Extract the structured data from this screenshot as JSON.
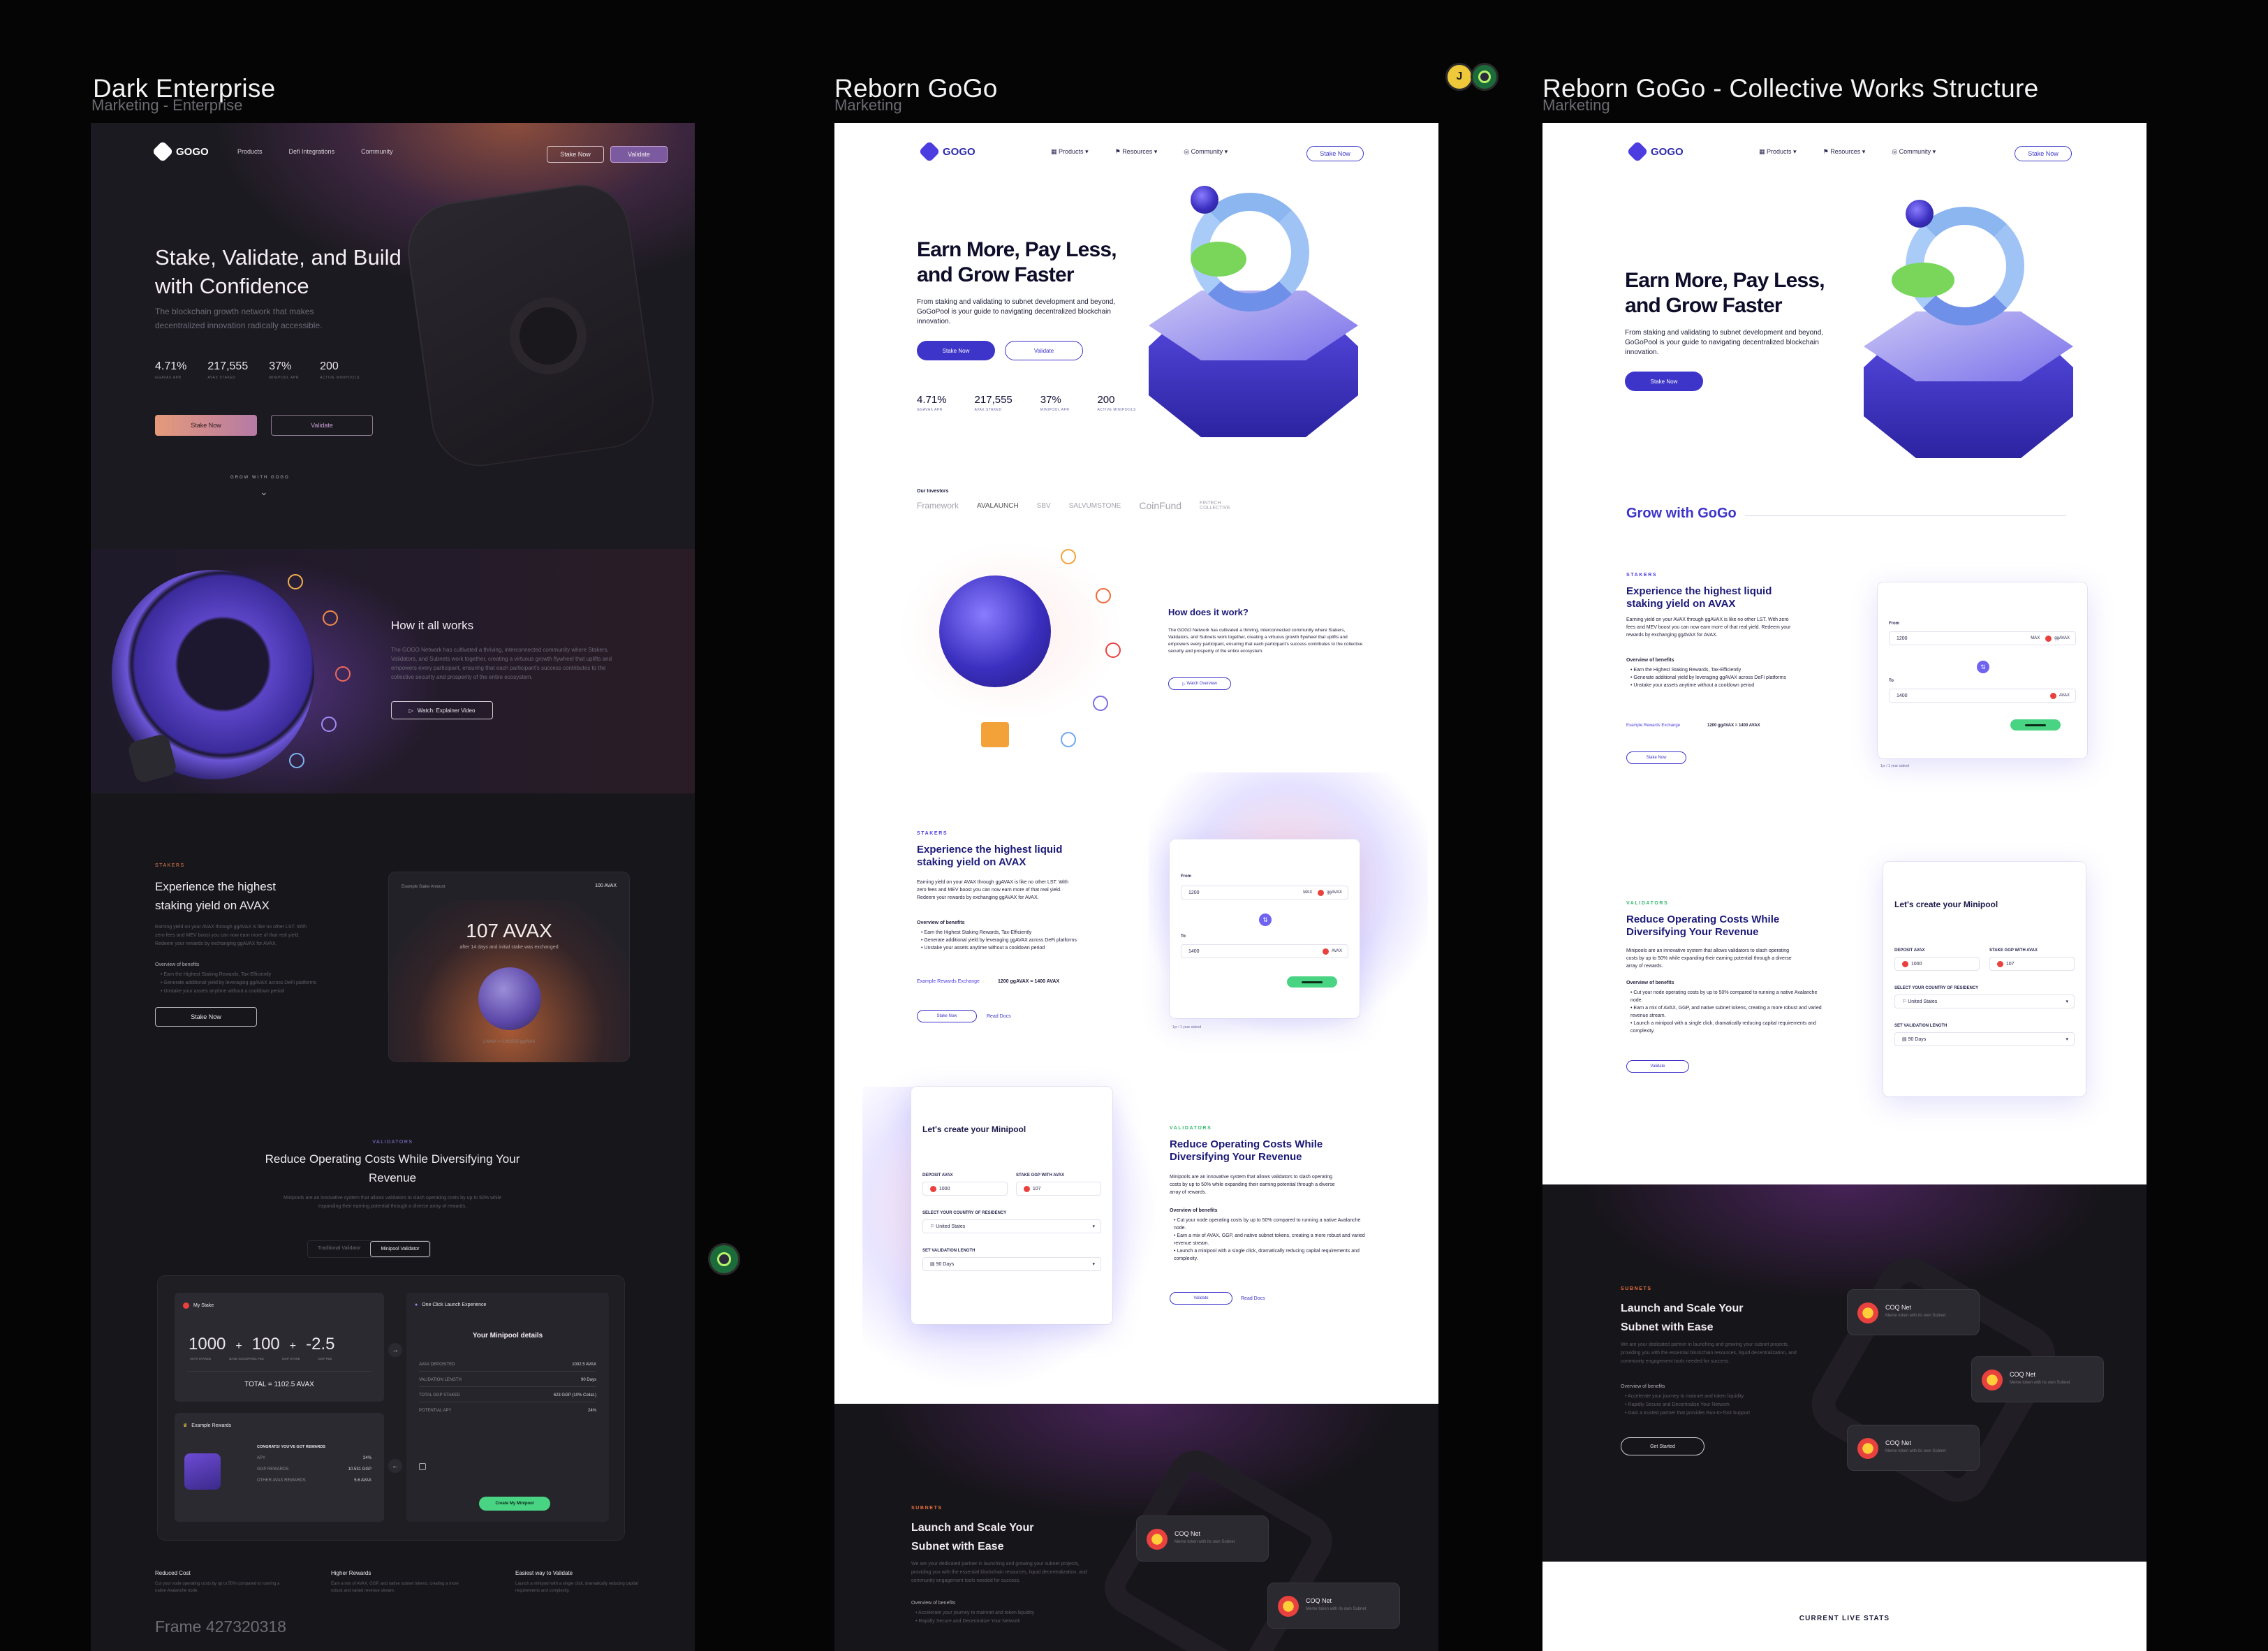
{
  "frames": [
    {
      "title": "Dark Enterprise",
      "subtitle": "Marketing - Enterprise"
    },
    {
      "title": "Reborn GoGo",
      "subtitle": "Marketing"
    },
    {
      "title": "Reborn GoGo - Collective Works Structure",
      "subtitle": "Marketing"
    }
  ],
  "dark": {
    "logo": "GOGO",
    "nav": [
      "Products",
      "Defi Integrations",
      "Community"
    ],
    "nav_buttons": [
      "Stake Now",
      "Validate"
    ],
    "hero_title": "Stake, Validate, and Build with Confidence",
    "hero_sub": "The blockchain growth network that makes decentralized innovation radically accessible.",
    "stats": [
      {
        "value": "4.71%",
        "label": "GGAVAX APR"
      },
      {
        "value": "217,555",
        "label": "AVAX STAKED"
      },
      {
        "value": "37%",
        "label": "MINIPOOL APR"
      },
      {
        "value": "200",
        "label": "ACTIVE MINIPOOLS"
      }
    ],
    "cta_primary": "Stake Now",
    "cta_secondary": "Validate",
    "grow": "GROW WITH GOGO",
    "how_title": "How it all works",
    "how_text": "The GOGO Network has cultivated a thriving, interconnected community where Stakers, Validators, and Subnets work together, creating a virtuous growth flywheel that uplifts and empowers every participant, ensuring that each participant's success contributes to the collective security and prosperity of the entire ecosystem.",
    "how_button": "Watch: Explainer Video",
    "stakers_tag": "STAKERS",
    "stakers_title": "Experience the highest staking yield on AVAX",
    "stakers_text": "Earning yield on your AVAX through ggAVAX is like no other LST. With zero fees and MEV boost you can now earn more of that real yield. Redeem your rewards by exchanging ggAVAX for AVAX.",
    "benefits_title": "Overview of benefits",
    "stakers_benefits": [
      "Earn the Highest Staking Rewards, Tax-Efficiently",
      "Generate additional yield by leveraging ggAVAX across DeFi platforms",
      "Unstake your assets anytime without a cooldown period"
    ],
    "stake_button": "Stake Now",
    "example_label": "Example Stake Amount",
    "example_value": "100 AVAX",
    "card_big": "107 AVAX",
    "card_sub": "after 14 days and initial stake was exchanged",
    "card_rate": "1 AVAX = 0.932535 ggAVAX",
    "validators_tag": "VALIDATORS",
    "validators_title": "Reduce Operating Costs While Diversifying Your Revenue",
    "validators_text": "Minipools are an innovative system that allows validators to slash operating costs by up to 50% while expanding their earning potential through a diverse array of rewards.",
    "tabs": [
      "Traditional Validator",
      "Minipool Validator"
    ],
    "my_stake": "My Stake",
    "calc": [
      "1000",
      "+",
      "100",
      "+",
      "-2.5"
    ],
    "calc_labels": [
      "AVAX STAKED",
      "BASE GOGOPOOL FEE",
      "GGP STAKE",
      "GGP FEE"
    ],
    "total": "TOTAL = 1102.5 AVAX",
    "one_click": "One Click Launch Experience",
    "minipool_details": "Your Minipool details",
    "details": [
      {
        "k": "AVAX DEPOSITED",
        "v": "1002.5 AVAX"
      },
      {
        "k": "VALIDATION LENGTH",
        "v": "90 Days"
      },
      {
        "k": "TOTAL GGP STAKED",
        "v": "623 GGP (10% Collat.)"
      },
      {
        "k": "POTENTIAL APY",
        "v": "24%"
      }
    ],
    "example_rewards": "Example Rewards",
    "congrats": "CONGRATS! YOU'VE GOT REWARDS",
    "rewards": [
      {
        "k": "APY",
        "v": "24%"
      },
      {
        "k": "GGP REWARDS",
        "v": "10.531 GGP"
      },
      {
        "k": "OTHER AVAX REWARDS",
        "v": "5.6 AVAX"
      }
    ],
    "create_button": "Create My Minipool",
    "features": [
      {
        "h": "Reduced Cost",
        "t": "Cut your node operating costs by up to 50% compared to running a native Avalanche node."
      },
      {
        "h": "Higher Rewards",
        "t": "Earn a mix of AVAX, GGP, and native subnet tokens, creating a more robust and varied revenue stream."
      },
      {
        "h": "Easiest way to Validate",
        "t": "Launch a minipool with a single click, dramatically reducing capital requirements and complexity."
      }
    ],
    "frame_label": "Frame 427320318"
  },
  "reborn": {
    "logo": "GOGO",
    "nav": [
      "Products",
      "Resources",
      "Community"
    ],
    "nav_button": "Stake Now",
    "hero_title": "Earn More, Pay Less, and Grow Faster",
    "hero_text": "From staking and validating to subnet development and beyond, GoGoPool is your guide to navigating decentralized blockchain innovation.",
    "cta_primary": "Stake Now",
    "cta_secondary": "Validate",
    "stats": [
      {
        "value": "4.71%",
        "label": "GGAVAX APR"
      },
      {
        "value": "217,555",
        "label": "AVAX STAKED"
      },
      {
        "value": "37%",
        "label": "MINIPOOL APR"
      },
      {
        "value": "200",
        "label": "ACTIVE MINIPOOLS"
      }
    ],
    "investors_label": "Our Investors",
    "investors": [
      "Framework",
      "AVALAUNCH",
      "SBV",
      "SALVUMSTONE",
      "CoinFund",
      "FINTECH COLLECTIVE"
    ],
    "how_title": "How does it work?",
    "how_text": "The GOGO Network has cultivated a thriving, interconnected community where Stakers, Validators, and Subnets work together, creating a virtuous growth flywheel that uplifts and empowers every participant, ensuring that each participant's success contributes to the collective security and prosperity of the entire ecosystem.",
    "how_button": "Watch Overview",
    "stakers_tag": "STAKERS",
    "stakers_title": "Experience the highest liquid staking yield on AVAX",
    "stakers_text": "Earning yield on your AVAX through ggAVAX is like no other LST. With zero fees and MEV boost you can now earn more of that real yield. Redeem your rewards by exchanging ggAVAX for AVAX.",
    "benefits_title": "Overview of benefits",
    "stakers_benefits": [
      "Earn the Highest Staking Rewards, Tax-Efficiently",
      "Generate additional yield by leveraging ggAVAX across DeFi platforms",
      "Unstake your assets anytime without a cooldown period"
    ],
    "exchange_label": "Example Rewards Exchange",
    "exchange_value": "1200 ggAVAX = 1400 AVAX",
    "stake_button": "Stake Now",
    "read_docs": "Read Docs",
    "swap": {
      "from_label": "From",
      "from_value": "1200",
      "max": "MAX",
      "from_token": "ggAVAX",
      "to_label": "To",
      "to_value": "1400",
      "to_token": "AVAX",
      "footnote": "1yr / 1 year staked"
    },
    "validators_tag": "VALIDATORS",
    "validators_title": "Reduce Operating Costs While Diversifying Your Revenue",
    "validators_text": "Minipools are an innovative system that allows validators to slash operating costs by up to 50% while expanding their earning potential through a diverse array of rewards.",
    "validators_benefits": [
      "Cut your node operating costs by up to 50% compared to running a native Avalanche node.",
      "Earn a mix of AVAX, GGP, and native subnet tokens, creating a more robust and varied revenue stream.",
      "Launch a minipool with a single click, dramatically reducing capital requirements and complexity."
    ],
    "validate_button": "Validate",
    "minipool_title": "Let's create your Minipool",
    "mp_fields": {
      "deposit_label": "DEPOSIT AVAX",
      "deposit": "1000",
      "ggp_label": "STAKE GGP WITH AVAX",
      "ggp": "107",
      "country_label": "SELECT YOUR COUNTRY OF RESIDENCY",
      "country": "United States",
      "length_label": "SET VALIDATION LENGTH",
      "length": "90 Days"
    },
    "subnets_tag": "SUBNETS",
    "subnets_title": "Launch and Scale Your Subnet with Ease",
    "subnets_text": "We are your dedicated partner in launching and growing your subnet projects, providing you with the essential blockchain resources, liquid decentralization, and community engagement tools needed for success.",
    "subnets_benefits": [
      "Accelerate your journey to mainnet and token liquidity",
      "Rapidly Secure and Decentralize Your Network",
      "Gain a trusted partner that provides Run-to-Tool Support"
    ],
    "subnet_card_name": "COQ Net",
    "subnet_card_desc": "Meme token with its own Subnet",
    "get_started": "Get Started",
    "grow_title": "Grow with GoGo",
    "live_stats": "CURRENT LIVE STATS"
  },
  "avatars": [
    "J"
  ],
  "colors": {
    "brand": "#3d34c9",
    "accent_orange": "#e37d4c",
    "green": "#49d483",
    "dark_bg": "#17171b"
  }
}
